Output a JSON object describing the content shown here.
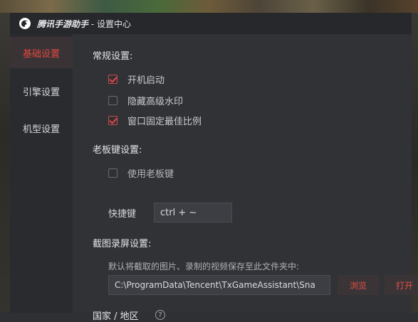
{
  "window": {
    "app_name": "腾讯手游助手",
    "separator": " - ",
    "page_name": "设置中心"
  },
  "sidebar": {
    "items": [
      {
        "label": "基础设置",
        "active": true
      },
      {
        "label": "引擎设置",
        "active": false
      },
      {
        "label": "机型设置",
        "active": false
      }
    ]
  },
  "general": {
    "title": "常规设置:",
    "options": [
      {
        "label": "开机启动",
        "checked": true
      },
      {
        "label": "隐藏高级水印",
        "checked": false
      },
      {
        "label": "窗口固定最佳比例",
        "checked": true
      }
    ]
  },
  "boss_key": {
    "title": "老板键设置:",
    "enable_label": "使用老板键",
    "enabled": false,
    "hotkey_label": "快捷键",
    "hotkey_value": "ctrl + ~"
  },
  "capture": {
    "title": "截图录屏设置:",
    "hint": "默认将截取的图片、录制的视频保存至此文件夹中:",
    "path": "C:\\ProgramData\\Tencent\\TxGameAssistant\\Sna",
    "browse_label": "浏览",
    "open_label": "打开"
  },
  "region": {
    "title": "国家 / 地区",
    "help_glyph": "?"
  },
  "colors": {
    "accent": "#e0483f",
    "background": "#303236",
    "sidebar": "#2a2b2f"
  }
}
